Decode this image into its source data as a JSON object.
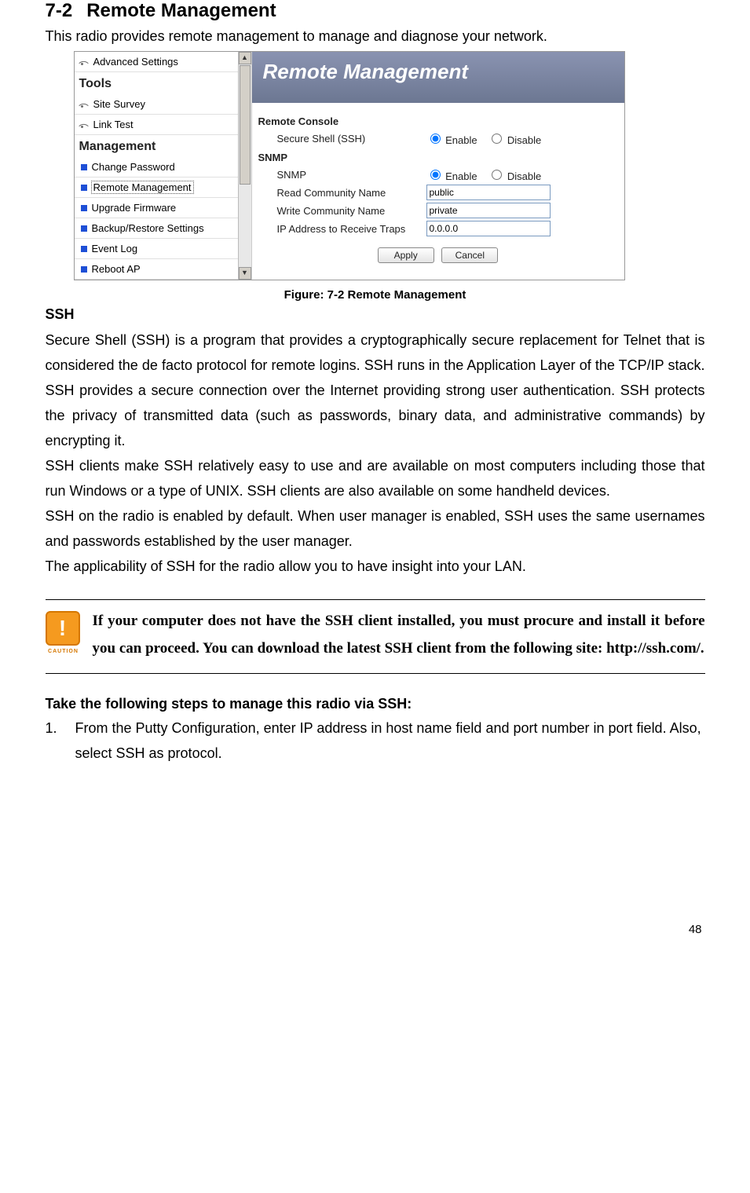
{
  "section": {
    "number": "7-2",
    "title": "Remote Management"
  },
  "intro": "This radio provides remote management to manage and diagnose your network.",
  "screenshot": {
    "banner": "Remote Management",
    "sidebar": {
      "top_item": "Advanced Settings",
      "group_tools": "Tools",
      "tools_items": [
        "Site Survey",
        "Link Test"
      ],
      "group_mgmt": "Management",
      "mgmt_items": [
        "Change Password",
        "Remote Management",
        "Upgrade Firmware",
        "Backup/Restore Settings",
        "Event Log",
        "Reboot AP"
      ]
    },
    "form": {
      "sec_console": "Remote Console",
      "row_ssh": "Secure Shell (SSH)",
      "enable": "Enable",
      "disable": "Disable",
      "sec_snmp": "SNMP",
      "row_snmp": "SNMP",
      "row_read": "Read Community Name",
      "val_read": "public",
      "row_write": "Write Community Name",
      "val_write": "private",
      "row_trap": "IP Address to Receive Traps",
      "val_trap": "0.0.0.0",
      "btn_apply": "Apply",
      "btn_cancel": "Cancel"
    }
  },
  "figure_caption": "Figure: 7-2 Remote Management",
  "ssh_head": "SSH",
  "ssh_para1": "Secure Shell (SSH) is a program that provides a cryptographically secure replacement for Telnet that is considered the de facto protocol for remote logins. SSH runs in the Application Layer of the TCP/IP stack. SSH provides a secure connection over the Internet providing strong user authentication. SSH protects the privacy of transmitted data (such as passwords, binary data, and administrative commands) by encrypting it.",
  "ssh_para2": "SSH clients make SSH relatively easy to use and are available on most computers including those that run Windows or a type of UNIX. SSH clients are also available on some handheld devices.",
  "ssh_para3": "SSH on the radio is enabled by default. When user manager is enabled, SSH uses the same usernames and passwords established by the user manager.",
  "ssh_para4": "The applicability of SSH for the radio allow you to have insight into your LAN.",
  "caution": "If your computer does not have the SSH client installed, you must procure and install it before you can proceed. You can download the latest SSH client from the following site: http://ssh.com/.",
  "caution_label": "CAUTION",
  "steps_head": "Take the following steps to manage this radio via SSH:",
  "step1_num": "1.",
  "step1": "From the Putty Configuration, enter IP address in host name field and port number in port field. Also, select SSH as protocol.",
  "page_number": "48"
}
